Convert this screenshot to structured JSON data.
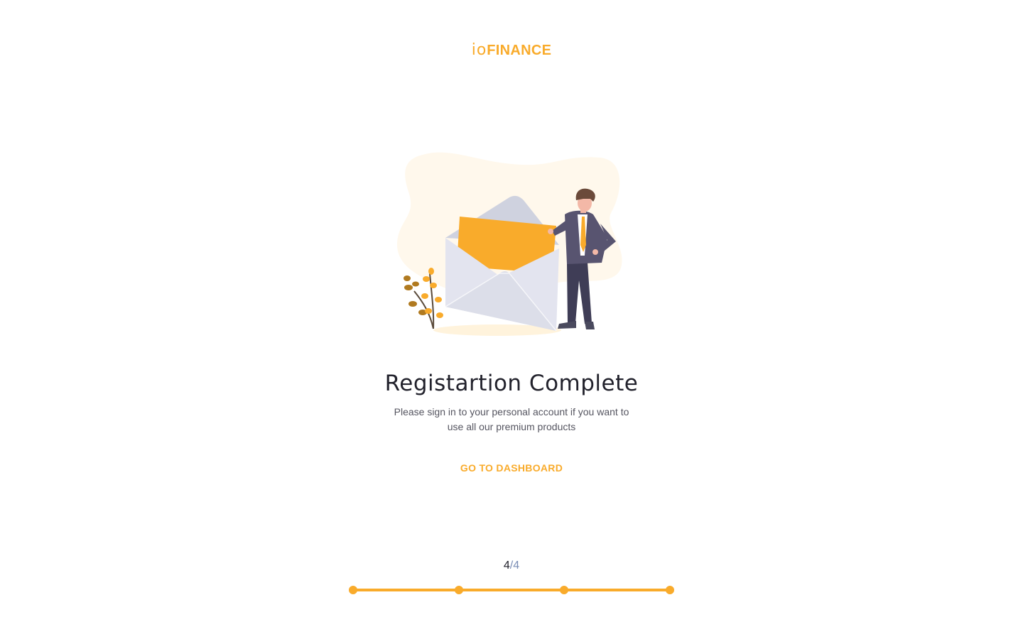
{
  "brand": {
    "logo_prefix": "io",
    "logo_name": "FINANCE",
    "color": "#f9ab2b"
  },
  "illustration": {
    "icon": "envelope-with-businessman-illustration"
  },
  "main": {
    "title": "Registartion Complete",
    "subtitle": "Please sign in to your personal account if you want to use all our premium products",
    "cta_label": "GO TO DASHBOARD"
  },
  "progress": {
    "current": "4",
    "separator": "/",
    "total": "4",
    "steps": 4,
    "completed_fraction": 1.0,
    "accent_color": "#f9ab2b"
  }
}
